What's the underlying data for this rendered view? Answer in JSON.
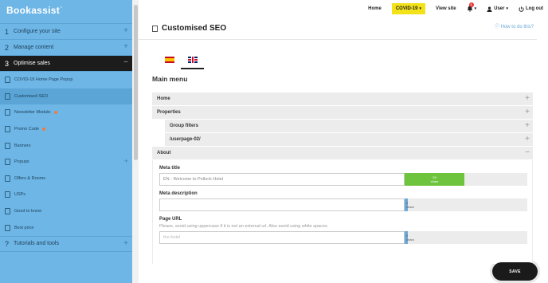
{
  "brand": {
    "name": "Bookassist",
    "mark": "°"
  },
  "sidebar": {
    "sections": [
      {
        "num": "1",
        "label": "Configure your site"
      },
      {
        "num": "2",
        "label": "Manage content"
      },
      {
        "num": "3",
        "label": "Optimise sales"
      }
    ],
    "items": [
      {
        "label": "COVID-19 Home Page Popup"
      },
      {
        "label": "Customised SEO"
      },
      {
        "label": "Newsletter Module"
      },
      {
        "label": "Promo Code"
      },
      {
        "label": "Banners"
      },
      {
        "label": "Popups"
      },
      {
        "label": "Offers & Rooms"
      },
      {
        "label": "USPs"
      },
      {
        "label": "Good to know"
      },
      {
        "label": "Best price"
      }
    ],
    "footer_section": {
      "num": "?",
      "label": "Tutorials and tools"
    }
  },
  "topbar": {
    "home": "Home",
    "covid": "COVID-19",
    "view_site": "View site",
    "notifications_count": "1",
    "user": "User",
    "logout": "Log out"
  },
  "page": {
    "title": "Customised SEO",
    "how_to": "How to do this?",
    "languages": [
      "es",
      "en"
    ],
    "active_language": "en",
    "section_title": "Main menu"
  },
  "rows": {
    "home": "Home",
    "properties": "Properties",
    "group_filters": "Group filters",
    "userpage": "/userpage-02/",
    "about": "About"
  },
  "fields": {
    "meta_title_label": "Meta title",
    "meta_title_value": "EN - Welcome to Pollock Hotel",
    "meta_title_count": "29",
    "meta_title_unit": "chars",
    "meta_description_label": "Meta description",
    "meta_description_value": "",
    "meta_description_count": "0",
    "meta_description_unit": "chars",
    "page_url_label": "Page URL",
    "page_url_help": "Please, avoid using uppercase if it is not an external url. Also avoid using white spaces.",
    "page_url_placeholder": "the-hotel",
    "page_url_count": "0",
    "page_url_unit": "chars"
  },
  "actions": {
    "save": "SAVE"
  },
  "colors": {
    "sidebar": "#6db6e6",
    "active_section": "#1c1c1c",
    "covid_highlight": "#f3e11a",
    "counter_ok": "#6fc43d",
    "counter_empty": "#6aa9d6",
    "save_button": "#1a1a1a",
    "badge_dot": "#f07c3c"
  }
}
